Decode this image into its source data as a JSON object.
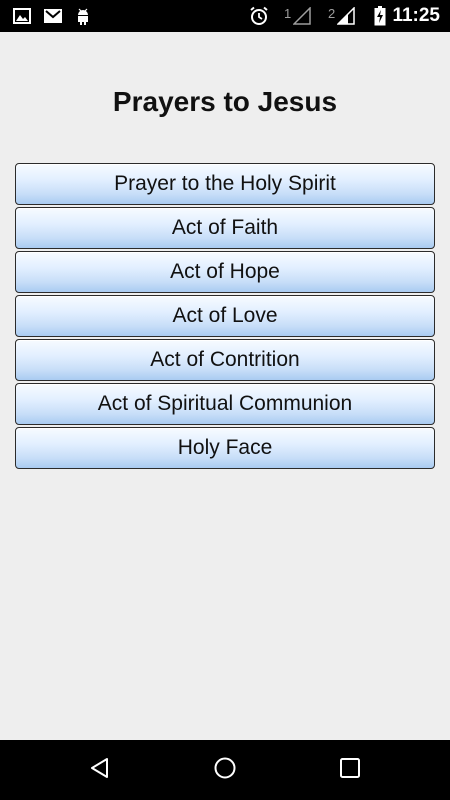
{
  "status_bar": {
    "time": "11:25",
    "sim1": "1",
    "sim2": "2",
    "icons": [
      "image-icon",
      "gmail-icon",
      "android-icon",
      "alarm-icon",
      "signal-icon",
      "signal-icon",
      "battery-icon"
    ]
  },
  "page": {
    "title": "Prayers to Jesus"
  },
  "prayers": [
    "Prayer to the Holy Spirit",
    "Act of Faith",
    "Act of Hope",
    "Act of Love",
    "Act of Contrition",
    "Act of Spiritual Communion",
    "Holy Face"
  ],
  "nav_bar": {
    "icons": [
      "back-icon",
      "home-icon",
      "recents-icon"
    ]
  }
}
